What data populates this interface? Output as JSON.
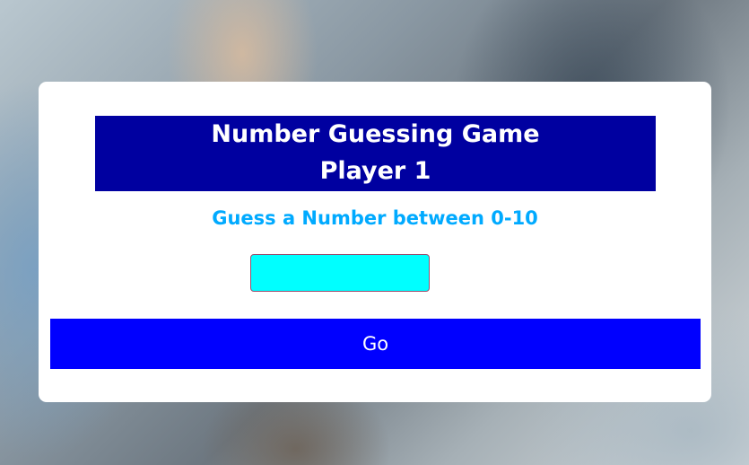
{
  "game": {
    "title": "Number Guessing Game",
    "player": "Player 1",
    "prompt": "Guess a Number between 0-10",
    "guess_input": {
      "value": "",
      "placeholder": ""
    },
    "go_label": "Go"
  },
  "colors": {
    "banner": "#0000a0",
    "prompt_text": "#00aaff",
    "input_background": "#00ffff",
    "button": "#0000ff"
  }
}
